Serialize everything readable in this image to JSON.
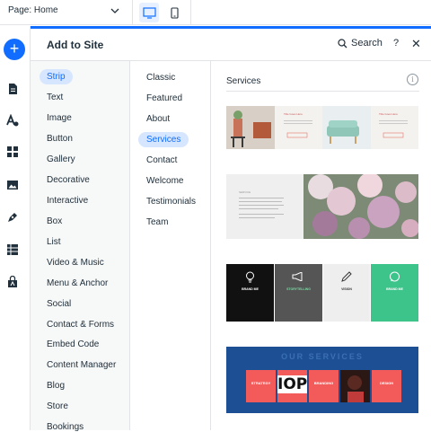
{
  "topbar": {
    "page_label": "Page: Home",
    "devices": [
      {
        "name": "desktop",
        "active": true
      },
      {
        "name": "mobile",
        "active": false
      }
    ]
  },
  "leftbar": {
    "add_label": "+",
    "icons": [
      "add-icon",
      "pages-icon",
      "design-icon",
      "apps-icon",
      "media-icon",
      "blog-icon",
      "table-icon",
      "market-icon"
    ]
  },
  "panel": {
    "title": "Add to Site",
    "search_label": "Search",
    "help_label": "?",
    "close_label": "✕"
  },
  "categories": [
    {
      "label": "Strip",
      "selected": true
    },
    {
      "label": "Text"
    },
    {
      "label": "Image"
    },
    {
      "label": "Button"
    },
    {
      "label": "Gallery"
    },
    {
      "label": "Decorative"
    },
    {
      "label": "Interactive"
    },
    {
      "label": "Box"
    },
    {
      "label": "List"
    },
    {
      "label": "Video & Music"
    },
    {
      "label": "Menu & Anchor"
    },
    {
      "label": "Social"
    },
    {
      "label": "Contact & Forms"
    },
    {
      "label": "Embed Code"
    },
    {
      "label": "Content Manager"
    },
    {
      "label": "Blog"
    },
    {
      "label": "Store"
    },
    {
      "label": "Bookings"
    }
  ],
  "subcategories": [
    {
      "label": "Classic"
    },
    {
      "label": "Featured"
    },
    {
      "label": "About"
    },
    {
      "label": "Services",
      "selected": true
    },
    {
      "label": "Contact"
    },
    {
      "label": "Welcome"
    },
    {
      "label": "Testimonials"
    },
    {
      "label": "Team"
    }
  ],
  "content": {
    "section_title": "Services",
    "info_icon": "i",
    "thumb1": {
      "heading_left": "Title Goes Here",
      "heading_right": "Title Goes Here",
      "btn": "Learn More"
    },
    "thumb2": {
      "label": "SERVICE"
    },
    "thumb3": {
      "cards": [
        {
          "title": "BRAND ME",
          "bg": "#111111",
          "fg": "#ffffff"
        },
        {
          "title": "STORYTELLING",
          "bg": "#555555",
          "fg": "#ffffff"
        },
        {
          "title": "VISION",
          "bg": "#eeeeee",
          "fg": "#333333"
        },
        {
          "title": "BRAND ME",
          "bg": "#3cc48b",
          "fg": "#ffffff"
        }
      ]
    },
    "thumb4": {
      "title": "OUR SERVICES",
      "cards": [
        "STRATEGY",
        "IOPS",
        "BRANDING",
        "",
        "DESIGN"
      ]
    }
  },
  "colors": {
    "accent": "#116dff",
    "selected_bg": "#d6e6fe",
    "thumb4_bg": "#1d4f94",
    "thumb4_card": "#f35b5b"
  }
}
